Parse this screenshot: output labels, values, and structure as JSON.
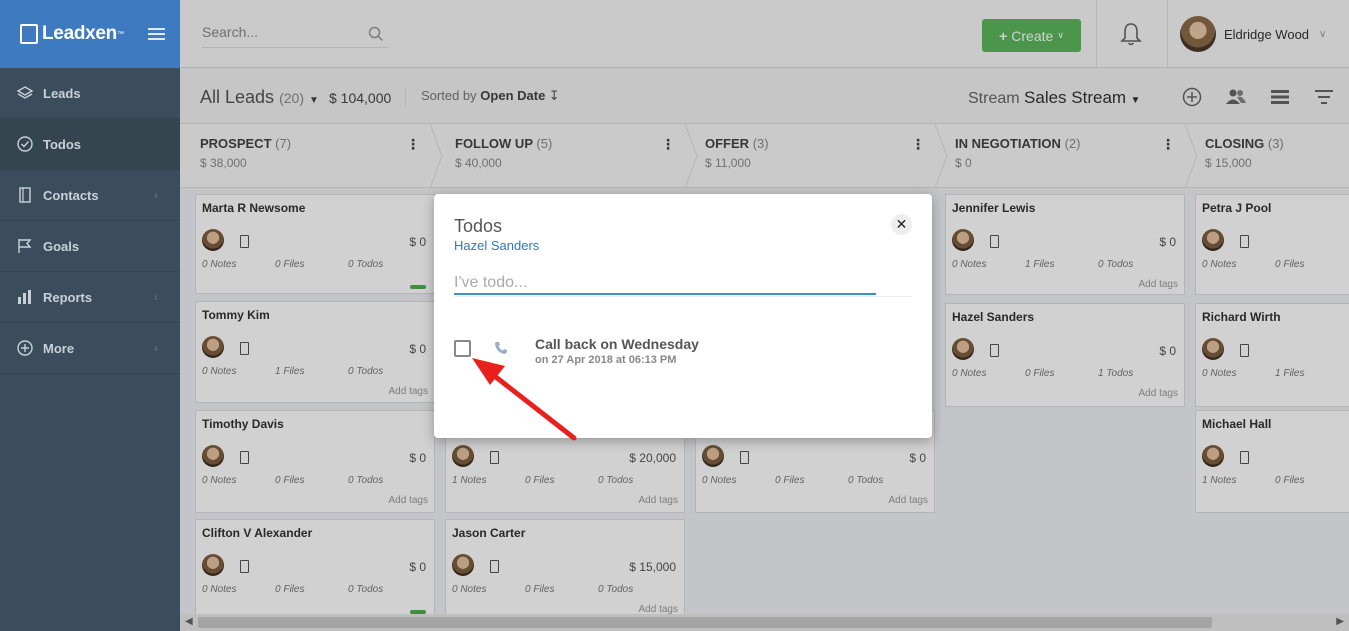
{
  "app": {
    "name": "Leadxen",
    "tm": "™"
  },
  "sidebar": {
    "items": [
      {
        "label": "Leads",
        "icon": "layers-icon"
      },
      {
        "label": "Todos",
        "icon": "check-circle-icon"
      },
      {
        "label": "Contacts",
        "icon": "address-book-icon"
      },
      {
        "label": "Goals",
        "icon": "flag-icon"
      },
      {
        "label": "Reports",
        "icon": "bar-chart-icon"
      },
      {
        "label": "More",
        "icon": "plus-circle-icon"
      }
    ]
  },
  "topbar": {
    "search_placeholder": "Search...",
    "create_label": "Create",
    "user_name": "Eldridge Wood"
  },
  "subbar": {
    "title": "All Leads",
    "count": "(20)",
    "amount": "$ 104,000",
    "sorted_prefix": "Sorted by",
    "sorted_field": "Open Date",
    "stream_prefix": "Stream",
    "stream_name": "Sales Stream"
  },
  "stages": [
    {
      "name": "PROSPECT",
      "count": "(7)",
      "amount": "$ 38,000"
    },
    {
      "name": "FOLLOW UP",
      "count": "(5)",
      "amount": "$ 40,000"
    },
    {
      "name": "OFFER",
      "count": "(3)",
      "amount": "$ 11,000"
    },
    {
      "name": "IN NEGOTIATION",
      "count": "(2)",
      "amount": "$ 0"
    },
    {
      "name": "CLOSING",
      "count": "(3)",
      "amount": "$ 15,000"
    }
  ],
  "cards": [
    {
      "name": "Marta R Newsome",
      "amount": "$ 0",
      "notes": "0 Notes",
      "files": "0 Files",
      "todos": "0 Todos",
      "tags": ""
    },
    {
      "name": "Tommy Kim",
      "amount": "$ 0",
      "notes": "0 Notes",
      "files": "1 Files",
      "todos": "0 Todos",
      "tags": "Add tags"
    },
    {
      "name": "Timothy Davis",
      "amount": "$ 0",
      "notes": "0 Notes",
      "files": "0 Files",
      "todos": "0 Todos",
      "tags": "Add tags"
    },
    {
      "name": "Clifton V Alexander",
      "amount": "$ 0",
      "notes": "0 Notes",
      "files": "0 Files",
      "todos": "0 Todos",
      "tags": ""
    },
    {
      "name": "",
      "amount": "$ 20,000",
      "notes": "1 Notes",
      "files": "0 Files",
      "todos": "0 Todos",
      "tags": "Add tags"
    },
    {
      "name": "Jason Carter",
      "amount": "$ 15,000",
      "notes": "0 Notes",
      "files": "0 Files",
      "todos": "0 Todos",
      "tags": "Add tags"
    },
    {
      "name": "",
      "amount": "$ 0",
      "notes": "0 Notes",
      "files": "0 Files",
      "todos": "0 Todos",
      "tags": "Add tags"
    },
    {
      "name": "Jennifer Lewis",
      "amount": "$ 0",
      "notes": "0 Notes",
      "files": "1 Files",
      "todos": "0 Todos",
      "tags": "Add tags"
    },
    {
      "name": "Hazel Sanders",
      "amount": "$ 0",
      "notes": "0 Notes",
      "files": "0 Files",
      "todos": "1 Todos",
      "tags": "Add tags"
    },
    {
      "name": "Petra J Pool",
      "amount": "",
      "notes": "0 Notes",
      "files": "0 Files",
      "todos": "",
      "tags": ""
    },
    {
      "name": "Richard Wirth",
      "amount": "",
      "notes": "0 Notes",
      "files": "1 Files",
      "todos": "",
      "tags": ""
    },
    {
      "name": "Michael Hall",
      "amount": "",
      "notes": "1 Notes",
      "files": "0 Files",
      "todos": "",
      "tags": ""
    }
  ],
  "modal": {
    "title": "Todos",
    "contact": "Hazel Sanders",
    "input_placeholder": "I've todo...",
    "todo": {
      "text": "Call back on Wednesday",
      "date": "on 27 Apr 2018 at 06:13 PM",
      "icon": "phone-icon"
    }
  },
  "colors": {
    "sidebar": "#3b4d5c",
    "brand": "#3e7ac0",
    "create": "#5cb85c",
    "link": "#2e78b7",
    "annotation_arrow": "#e8211d"
  }
}
